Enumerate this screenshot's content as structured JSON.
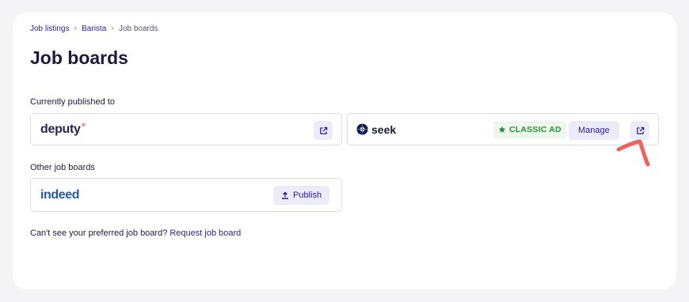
{
  "breadcrumb": {
    "items": [
      "Job listings",
      "Barista"
    ],
    "current": "Job boards",
    "separator": "›"
  },
  "page_title": "Job boards",
  "published_section": {
    "label": "Currently published to",
    "boards": [
      {
        "name": "deputy",
        "logo_mark": "*",
        "action_icon": "external-link-icon"
      },
      {
        "name": "seek",
        "badge": "CLASSIC AD",
        "badge_icon": "star-icon",
        "manage_label": "Manage",
        "action_icon": "external-link-icon"
      }
    ]
  },
  "other_section": {
    "label": "Other job boards",
    "boards": [
      {
        "name": "indeed",
        "publish_label": "Publish",
        "publish_icon": "upload-icon"
      }
    ]
  },
  "footer": {
    "text": "Can't see your preferred job board?",
    "link": "Request job board"
  },
  "colors": {
    "brand": "#2a1f8f",
    "badge_green": "#2f8a3a",
    "annotation": "#f0625a",
    "deputy_accent": "#ef6b5e",
    "indeed_blue": "#2557a7"
  }
}
